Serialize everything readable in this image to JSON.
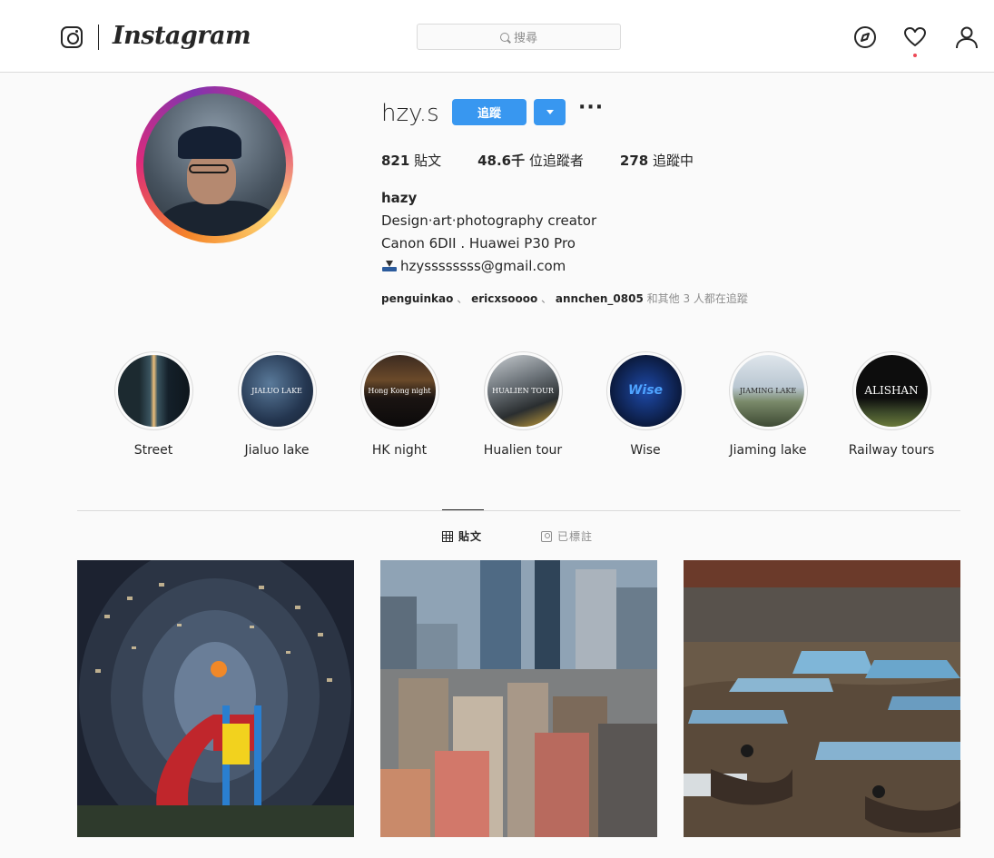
{
  "nav": {
    "wordmark": "Instagram",
    "search_placeholder": "搜尋",
    "icons": [
      "camera-icon",
      "explore-icon",
      "heart-icon",
      "user-icon"
    ],
    "notification_dot_color": "#ed4956"
  },
  "profile": {
    "username": "hzy.s",
    "follow_label": "追蹤",
    "more_label": "···",
    "stats": {
      "posts_count": "821",
      "posts_label": "貼文",
      "followers_count": "48.6千",
      "followers_label": "位追蹤者",
      "following_count": "278",
      "following_label": "追蹤中"
    },
    "bio": {
      "name": "hazy",
      "line1": "Design‧art‧photography creator",
      "line2": "Canon 6DII . Huawei P30 Pro",
      "email": "hzyssssssss@gmail.com"
    },
    "followed_by": {
      "user1": "penguinkao",
      "sep": "、",
      "user2": "ericxsoooo",
      "user3": "annchen_0805",
      "suffix": "和其他 3 人都在追蹤"
    }
  },
  "highlights": [
    {
      "label": "Street",
      "inner_text": ""
    },
    {
      "label": "Jialuo lake",
      "inner_text": "JIALUO LAKE"
    },
    {
      "label": "HK night",
      "inner_text": "Hong Kong night"
    },
    {
      "label": "Hualien tour",
      "inner_text": "HUALIEN TOUR"
    },
    {
      "label": "Wise",
      "inner_text": "Wise"
    },
    {
      "label": "Jiaming lake",
      "inner_text": "JIAMING LAKE"
    },
    {
      "label": "Railway tours",
      "inner_text": "ALISHAN"
    }
  ],
  "tabs": {
    "posts_label": "貼文",
    "tagged_label": "已標註"
  },
  "posts": [
    {
      "subject": "round-tower-playground"
    },
    {
      "subject": "city-skyline"
    },
    {
      "subject": "floating-market-boats"
    }
  ],
  "colors": {
    "accent": "#3897f0",
    "text": "#262626",
    "muted": "#8e8e8e",
    "border": "#dbdbdb",
    "background": "#fafafa"
  }
}
